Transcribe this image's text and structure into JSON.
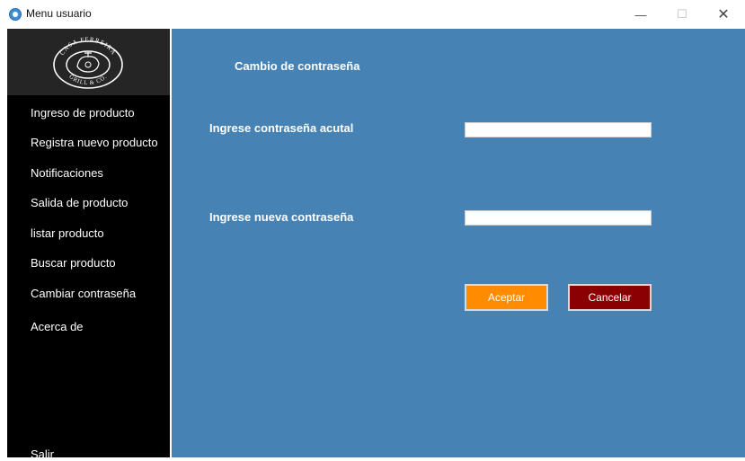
{
  "window": {
    "title": "Menu usuario",
    "minimize_glyph": "—",
    "maximize_glyph": "☐",
    "close_glyph": "✕"
  },
  "colors": {
    "sidebar_bg": "#000000",
    "logo_bg": "#252525",
    "main_bg": "#4682b4",
    "accept_bg": "#ff8c00",
    "cancel_bg": "#8b0000"
  },
  "logo": {
    "top_text": "CASA FERREIRA",
    "bottom_text": "GRILL & CO."
  },
  "sidebar": {
    "items": [
      {
        "label": "Ingreso de producto"
      },
      {
        "label": "Registra nuevo producto"
      },
      {
        "label": "Notificaciones"
      },
      {
        "label": "Salida de producto"
      },
      {
        "label": "listar producto"
      },
      {
        "label": "Buscar producto"
      },
      {
        "label": "Cambiar contraseña"
      },
      {
        "label": "Acerca de"
      }
    ],
    "exit_label": "Salir"
  },
  "form": {
    "heading": "Cambio de contraseña",
    "current_label": "Ingrese contraseña acutal",
    "current_value": "",
    "new_label": "Ingrese nueva contraseña",
    "new_value": "",
    "accept_label": "Aceptar",
    "cancel_label": "Cancelar"
  }
}
